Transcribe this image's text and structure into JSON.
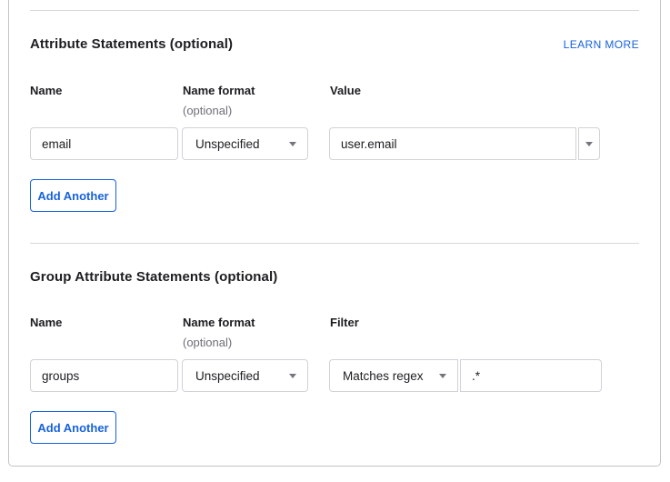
{
  "colors": {
    "accent_blue": "#1662dd",
    "text_dark": "#1d1d21",
    "text_muted": "#6e6e78"
  },
  "attribute_section": {
    "title": "Attribute Statements (optional)",
    "learn_more": "LEARN MORE",
    "columns": {
      "name": "Name",
      "format": "Name format",
      "format_note": "(optional)",
      "value": "Value"
    },
    "row": {
      "name": "email",
      "format": "Unspecified",
      "value": "user.email"
    },
    "icons": {
      "format_dropdown": "chevron-down-icon",
      "value_dropdown": "chevron-down-icon"
    },
    "add_button": "Add Another"
  },
  "group_section": {
    "title": "Group Attribute Statements (optional)",
    "columns": {
      "name": "Name",
      "format": "Name format",
      "format_note": "(optional)",
      "filter": "Filter"
    },
    "row": {
      "name": "groups",
      "format": "Unspecified",
      "filter": "Matches regex",
      "filter_value": ".*"
    },
    "icons": {
      "format_dropdown": "chevron-down-icon",
      "filter_dropdown": "chevron-down-icon"
    },
    "add_button": "Add Another"
  }
}
